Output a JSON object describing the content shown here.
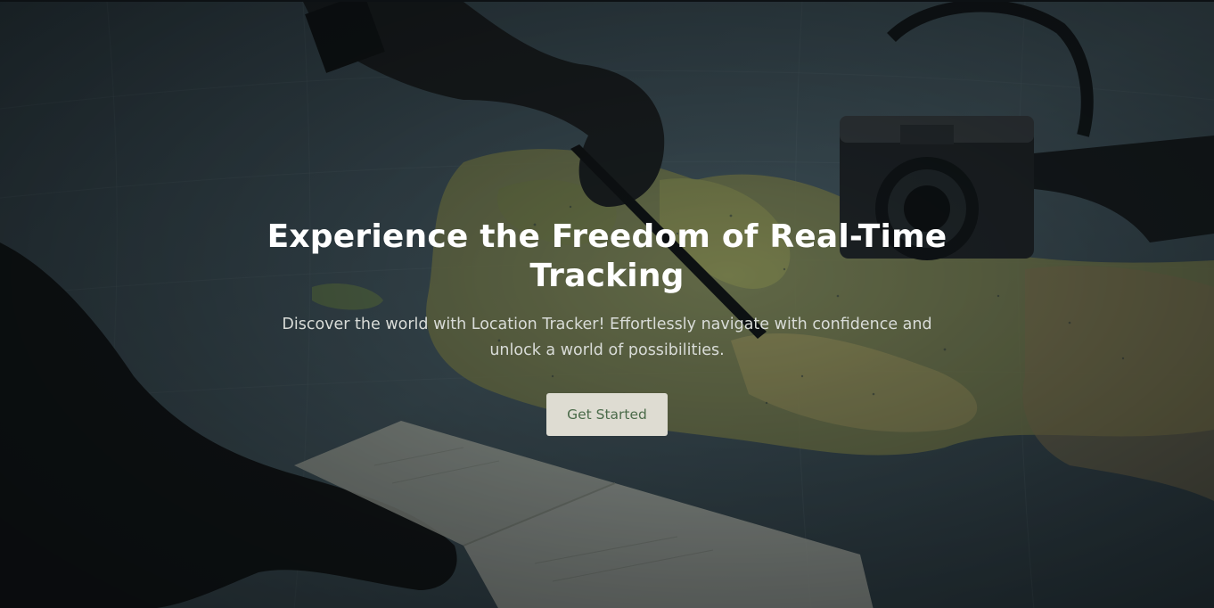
{
  "hero": {
    "title": "Experience the Freedom of Real-Time Tracking",
    "subtitle": "Discover the world with Location Tracker! Effortlessly navigate with confidence and unlock a world of possibilities.",
    "cta_label": "Get Started"
  },
  "colors": {
    "title_text": "#ffffff",
    "subtitle_text": "#d9dcd8",
    "button_bg": "#dedcd2",
    "button_text": "#4b6b4a",
    "overlay": "#1d2529"
  },
  "background": {
    "icon": "world-map-photo"
  }
}
